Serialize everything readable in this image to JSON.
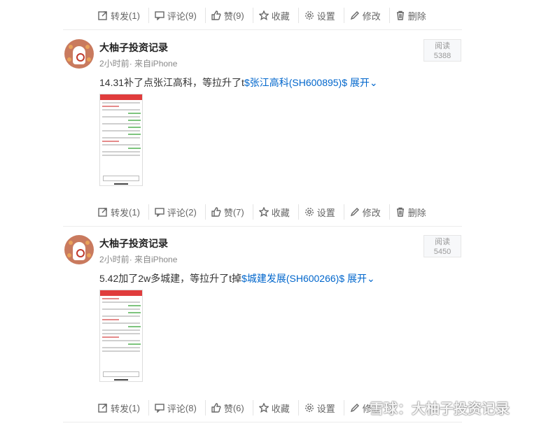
{
  "actions": {
    "repost": "转发",
    "comment": "评论",
    "like": "赞",
    "favorite": "收藏",
    "settings": "设置",
    "edit": "修改",
    "delete": "删除"
  },
  "top_bar": {
    "repost_count": "(1)",
    "comment_count": "(9)",
    "like_count": "(9)"
  },
  "posts": [
    {
      "author": "大柚子投资记录",
      "time": "2小时前",
      "source": "· 来自iPhone",
      "read_label": "阅读",
      "read_count": "5388",
      "text": "14.31补了点张江高科，等拉升了t",
      "stock_link": "$张江高科(SH600895)$",
      "expand": "展开",
      "counts": {
        "repost": "(1)",
        "comment": "(2)",
        "like": "(7)"
      }
    },
    {
      "author": "大柚子投资记录",
      "time": "2小时前",
      "source": "· 来自iPhone",
      "read_label": "阅读",
      "read_count": "5450",
      "text": "5.42加了2w多城建，等拉升了t掉",
      "stock_link": "$城建发展(SH600266)$",
      "expand": "展开",
      "counts": {
        "repost": "(1)",
        "comment": "(8)",
        "like": "(6)"
      }
    }
  ],
  "watermark": "雪球：大柚子投资记录"
}
